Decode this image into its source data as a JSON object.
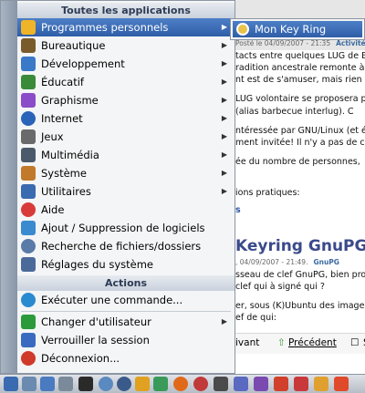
{
  "page": {
    "top_meta": "Posté le 04/09/2007 - 21:35",
    "top_tag": "Activité",
    "lines": [
      "tacts entre quelques LUG de B",
      "radition ancestrale remonte à",
      "nt est de s'amuser, mais rien",
      "LUG volontaire se proposera p",
      "(alias barbecue interlug). C",
      "ntéressée par GNU/Linux (et é",
      "ment invitée! Il n'y a pas de c",
      "ée du nombre de personnes,",
      "ions pratiques:",
      "s"
    ],
    "article_title": "Keyring GnuPG",
    "article_meta": ", 04/09/2007 - 21:49.",
    "article_tag": "GnuPG",
    "lines2": [
      "sseau de clef GnuPG, bien pro",
      "clef qui à signé qui ?",
      "er, sous (K)Ubuntu des image",
      "ef de qui:"
    ],
    "nav": {
      "suivant": "ivant",
      "precedent": "Précédent",
      "sommaire": "Su"
    }
  },
  "menu": {
    "section_apps": "Toutes les applications",
    "section_actions": "Actions",
    "apps": [
      {
        "label": "Programmes personnels",
        "icon": "star-folder-icon",
        "color": "#f0b428",
        "submenu": true
      },
      {
        "label": "Bureautique",
        "icon": "office-icon",
        "color": "#7a5b2c",
        "submenu": true
      },
      {
        "label": "Développement",
        "icon": "development-icon",
        "color": "#3a78c8",
        "submenu": true
      },
      {
        "label": "Éducatif",
        "icon": "education-icon",
        "color": "#3a8a3a",
        "submenu": true
      },
      {
        "label": "Graphisme",
        "icon": "graphics-icon",
        "color": "#8a4cc8",
        "submenu": true
      },
      {
        "label": "Internet",
        "icon": "globe-icon",
        "color": "#2a63b8",
        "submenu": true
      },
      {
        "label": "Jeux",
        "icon": "games-icon",
        "color": "#6a6a6a",
        "submenu": true
      },
      {
        "label": "Multimédia",
        "icon": "multimedia-icon",
        "color": "#4a5a6a",
        "submenu": true
      },
      {
        "label": "Système",
        "icon": "system-icon",
        "color": "#c07a2a",
        "submenu": true
      },
      {
        "label": "Utilitaires",
        "icon": "utilities-icon",
        "color": "#3a6ab0",
        "submenu": true
      },
      {
        "label": "Aide",
        "icon": "help-icon",
        "color": "#d83a3a",
        "submenu": false
      },
      {
        "label": "Ajout / Suppression de logiciels",
        "icon": "add-remove-software-icon",
        "color": "#3a8ad0",
        "submenu": false
      },
      {
        "label": "Recherche de fichiers/dossiers",
        "icon": "search-files-icon",
        "color": "#5a7aa8",
        "submenu": false
      },
      {
        "label": "Réglages du système",
        "icon": "system-settings-icon",
        "color": "#4a6a9a",
        "submenu": false
      }
    ],
    "actions": [
      {
        "label": "Exécuter une commande...",
        "icon": "run-command-icon",
        "color": "#2a8ad0",
        "submenu": false
      },
      {
        "label": "Changer d'utilisateur",
        "icon": "switch-user-icon",
        "color": "#2a9a3a",
        "submenu": true
      },
      {
        "label": "Verrouiller la session",
        "icon": "lock-icon",
        "color": "#3a6ac0",
        "submenu": false
      },
      {
        "label": "Déconnexion...",
        "icon": "logout-icon",
        "color": "#d03a2a",
        "submenu": false
      }
    ],
    "submenu_item": {
      "label": "Mon Key Ring",
      "icon": "keyring-icon"
    }
  },
  "taskbar": {
    "icons": [
      {
        "icon": "kmenu-icon",
        "color": "#3a6ab0"
      },
      {
        "icon": "home-icon",
        "color": "#6a8ab0"
      },
      {
        "icon": "konqueror-icon",
        "color": "#4a7ac0"
      },
      {
        "icon": "settings-icon",
        "color": "#7a8a9a"
      },
      {
        "icon": "terminal-icon",
        "color": "#2a2a2a"
      },
      {
        "icon": "network-icon",
        "color": "#5a8ac0"
      },
      {
        "icon": "browser-icon",
        "color": "#3a5a8a"
      },
      {
        "icon": "star-icon",
        "color": "#e0a020"
      },
      {
        "icon": "chat-icon",
        "color": "#3a9a5a"
      },
      {
        "icon": "firefox-icon",
        "color": "#e06a1a"
      },
      {
        "icon": "media-icon",
        "color": "#c03a3a"
      },
      {
        "icon": "bird-icon",
        "color": "#4a4a4a"
      },
      {
        "icon": "tools-icon",
        "color": "#5a6ac0"
      },
      {
        "icon": "image-viewer-icon",
        "color": "#7a4ab0"
      },
      {
        "icon": "office-suite-icon",
        "color": "#d0402a"
      },
      {
        "icon": "editor-icon",
        "color": "#c83a3a"
      },
      {
        "icon": "download-icon",
        "color": "#e0a030"
      },
      {
        "icon": "app-icon",
        "color": "#e04a2a"
      }
    ]
  }
}
